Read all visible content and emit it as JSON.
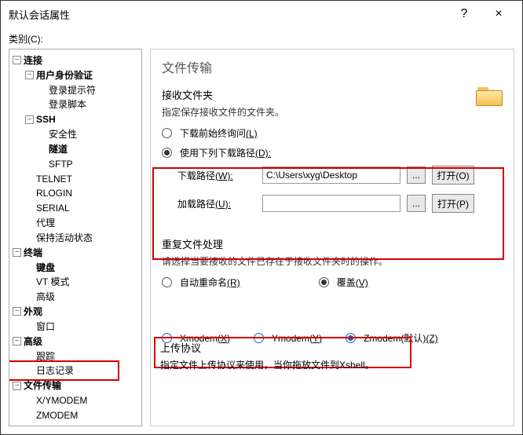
{
  "window": {
    "title": "默认会话属性",
    "help": "?",
    "close": "×"
  },
  "category_label": "类别(C):",
  "tree": {
    "connect": "连接",
    "user_auth": "用户身份验证",
    "login_prompt": "登录提示符",
    "login_script": "登录脚本",
    "ssh": "SSH",
    "security": "安全性",
    "tunnel": "隧道",
    "sftp": "SFTP",
    "telnet": "TELNET",
    "rlogin": "RLOGIN",
    "serial": "SERIAL",
    "proxy": "代理",
    "keepalive": "保持活动状态",
    "terminal": "终端",
    "keyboard": "键盘",
    "vt_mode": "VT 模式",
    "advanced1": "高级",
    "appearance": "外观",
    "window": "窗口",
    "advanced2": "高级",
    "trace": "跟踪",
    "logging": "日志记录",
    "file_transfer": "文件传输",
    "xymodem": "X/YMODEM",
    "zmodem": "ZMODEM"
  },
  "panel": {
    "title": "文件传输",
    "recv_head": "接收文件夹",
    "recv_desc": "指定保存接收文件的文件夹。",
    "radio_ask": "下载前始终询问",
    "radio_ask_u": "(L)",
    "radio_use": "使用下列下载路径",
    "radio_use_u": "(D):",
    "dl_label": "下载路径",
    "dl_label_u": "(W):",
    "dl_path": "C:\\Users\\xyg\\Desktop",
    "open1": "打开(O)",
    "load_label": "加载路径",
    "load_label_u": "(U):",
    "load_path": "",
    "open2": "打开(P)",
    "dots": "...",
    "dup_head": "重复文件处理",
    "dup_desc": "请选择当要接收的文件已存在于接收文件夹时的操作。",
    "auto_rename": "自动重命名",
    "auto_rename_u": "(R)",
    "overwrite": "覆盖",
    "overwrite_u": "(V)",
    "proto_head": "上传协议",
    "proto_desc": "指定文件上传协议来使用，当你拖放文件到Xshell。",
    "xmodem": "Xmodem",
    "xmodem_u": "(X)",
    "ymodem": "Ymodem",
    "ymodem_u": "(Y)",
    "zmodem": "Zmodem(默认)",
    "zmodem_u": "(Z)"
  }
}
